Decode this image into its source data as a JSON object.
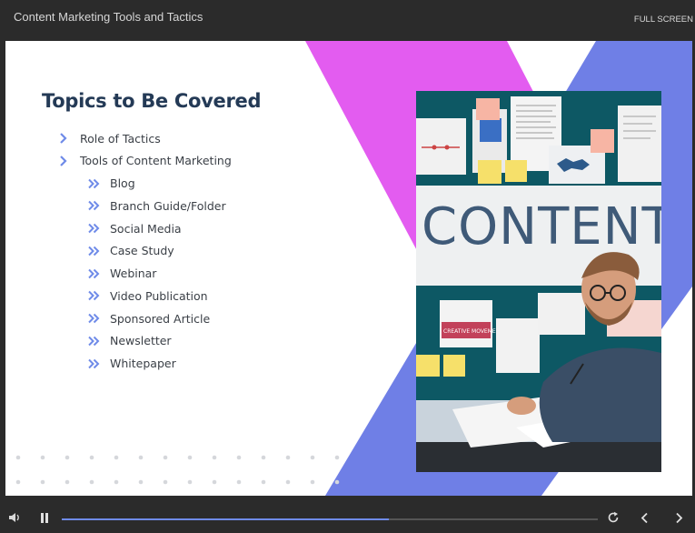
{
  "window": {
    "title": "Content Marketing Tools and Tactics",
    "fullscreen_label": "FULL SCREEN"
  },
  "slide": {
    "heading": "Topics to Be Covered",
    "topics": [
      {
        "label": "Role of Tactics",
        "level": 1
      },
      {
        "label": "Tools of Content Marketing",
        "level": 1
      },
      {
        "label": "Blog",
        "level": 2
      },
      {
        "label": "Branch Guide/Folder",
        "level": 2
      },
      {
        "label": "Social Media",
        "level": 2
      },
      {
        "label": "Case Study",
        "level": 2
      },
      {
        "label": "Webinar",
        "level": 2
      },
      {
        "label": "Video Publication",
        "level": 2
      },
      {
        "label": "Sponsored Article",
        "level": 2
      },
      {
        "label": "Newsletter",
        "level": 2
      },
      {
        "label": "Whitepaper",
        "level": 2
      }
    ],
    "photo": {
      "word": "CONTENT",
      "note_text": "CREATIVE MOVEMENT"
    },
    "colors": {
      "heading": "#243a56",
      "bullet": "#6f8be8",
      "magenta": "#e35cf0",
      "blue": "#6f7fe6"
    }
  },
  "player": {
    "progress": 0.61,
    "icons": [
      "volume-icon",
      "pause-icon",
      "replay-icon",
      "previous-icon",
      "next-icon"
    ]
  }
}
